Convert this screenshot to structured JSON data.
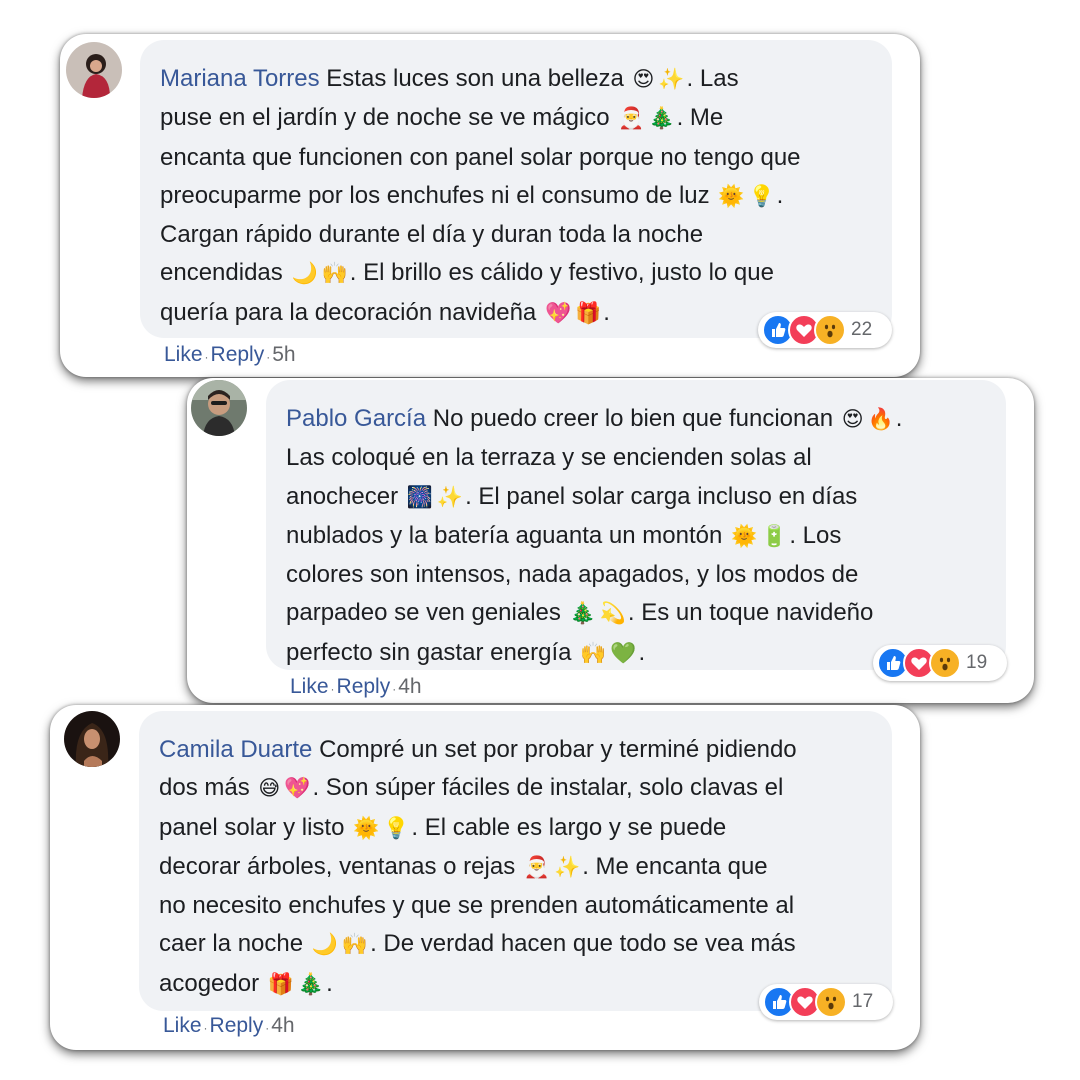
{
  "comments": [
    {
      "author": "Mariana Torres",
      "lines": [
        [
          {
            "t": "Estas luces son una belleza "
          },
          {
            "e": "😍"
          },
          {
            "e": "✨"
          },
          {
            "t": ". Las"
          }
        ],
        [
          {
            "t": "puse en el jardín y de noche se ve mágico "
          },
          {
            "e": "🎅"
          },
          {
            "e": "🎄"
          },
          {
            "t": ". Me"
          }
        ],
        [
          {
            "t": "encanta que funcionen con panel solar porque no tengo que"
          }
        ],
        [
          {
            "t": "preocuparme por los enchufes ni el consumo de luz "
          },
          {
            "e": "🌞"
          },
          {
            "e": "💡"
          },
          {
            "t": "."
          }
        ],
        [
          {
            "t": "Cargan rápido durante el día y duran toda la noche"
          }
        ],
        [
          {
            "t": "encendidas "
          },
          {
            "e": "🌙"
          },
          {
            "e": "🙌"
          },
          {
            "t": ". El brillo es cálido y festivo, justo lo que"
          }
        ],
        [
          {
            "t": "quería para la decoración navideña "
          },
          {
            "e": "💖"
          },
          {
            "e": "🎁"
          },
          {
            "t": "."
          }
        ]
      ],
      "reaction_count": "22",
      "actions": {
        "like": "Like",
        "reply": "Reply",
        "time": "5h"
      }
    },
    {
      "author": "Pablo García",
      "lines": [
        [
          {
            "t": "No puedo creer lo bien que funcionan "
          },
          {
            "e": "😍"
          },
          {
            "e": "🔥"
          },
          {
            "t": "."
          }
        ],
        [
          {
            "t": "Las coloqué en la terraza y se encienden solas al"
          }
        ],
        [
          {
            "t": "anochecer "
          },
          {
            "e": "🎆"
          },
          {
            "e": "✨"
          },
          {
            "t": ". El panel solar carga incluso en días"
          }
        ],
        [
          {
            "t": "nublados y la batería aguanta un montón "
          },
          {
            "e": "🌞"
          },
          {
            "e": "🔋"
          },
          {
            "t": ". Los"
          }
        ],
        [
          {
            "t": "colores son intensos, nada apagados, y los modos de"
          }
        ],
        [
          {
            "t": "parpadeo se ven geniales "
          },
          {
            "e": "🎄"
          },
          {
            "e": "💫"
          },
          {
            "t": ". Es un toque navideño"
          }
        ],
        [
          {
            "t": "perfecto sin gastar energía "
          },
          {
            "e": "🙌"
          },
          {
            "e": "💚"
          },
          {
            "t": "."
          }
        ]
      ],
      "reaction_count": "19",
      "actions": {
        "like": "Like",
        "reply": "Reply",
        "time": "4h"
      }
    },
    {
      "author": "Camila Duarte",
      "lines": [
        [
          {
            "t": "Compré un set por probar y terminé pidiendo"
          }
        ],
        [
          {
            "t": "dos más "
          },
          {
            "e": "😅"
          },
          {
            "e": "💖"
          },
          {
            "t": ". Son súper fáciles de instalar, solo clavas el"
          }
        ],
        [
          {
            "t": "panel solar y listo "
          },
          {
            "e": "🌞"
          },
          {
            "e": "💡"
          },
          {
            "t": ". El cable es largo y se puede"
          }
        ],
        [
          {
            "t": "decorar árboles, ventanas o rejas "
          },
          {
            "e": "🎅"
          },
          {
            "e": "✨"
          },
          {
            "t": ". Me encanta que"
          }
        ],
        [
          {
            "t": "no necesito enchufes y que se prenden automáticamente al"
          }
        ],
        [
          {
            "t": "caer la noche "
          },
          {
            "e": "🌙"
          },
          {
            "e": "🙌"
          },
          {
            "t": ". De verdad hacen que todo se vea más"
          }
        ],
        [
          {
            "t": "acogedor "
          },
          {
            "e": "🎁"
          },
          {
            "e": "🎄"
          },
          {
            "t": "."
          }
        ]
      ],
      "reaction_count": "17",
      "actions": {
        "like": "Like",
        "reply": "Reply",
        "time": "4h"
      }
    }
  ],
  "icons": {
    "avatar": "profile-photo",
    "reactions": [
      "like-icon",
      "love-icon",
      "wow-icon"
    ]
  },
  "colors": {
    "author": "#385898",
    "bubble": "#f0f2f5",
    "like": "#1877f2",
    "love": "#f33e58",
    "wow": "#f7b125",
    "meta": "#65676b"
  }
}
